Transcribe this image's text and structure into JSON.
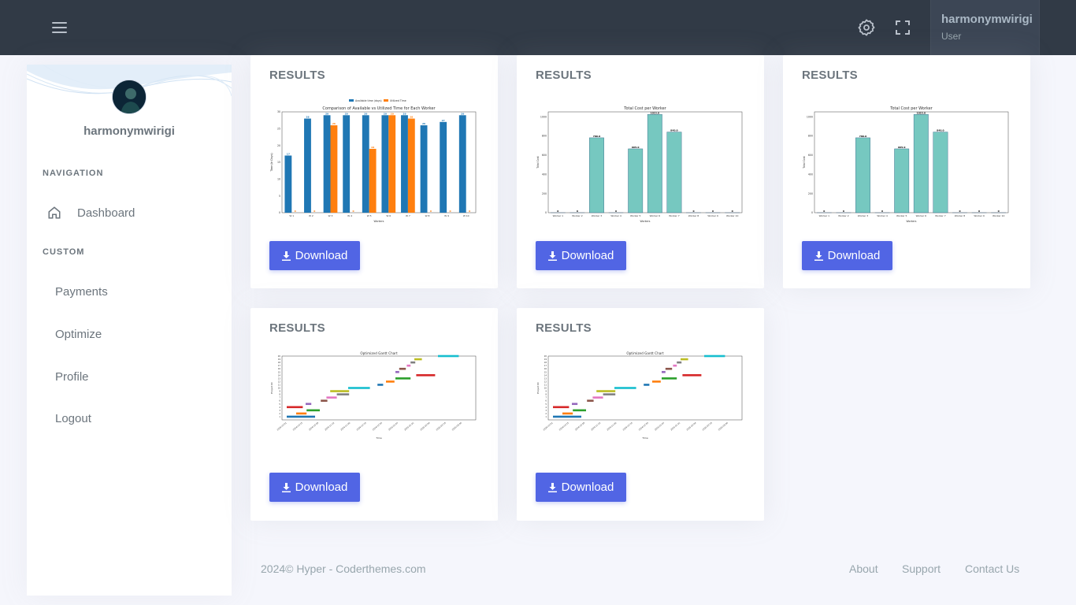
{
  "topbar": {
    "icons": [
      "menu-icon",
      "settings-icon",
      "fullscreen-icon"
    ],
    "user_name": "harmonymwirigi",
    "user_role": "User"
  },
  "sidebar": {
    "username": "harmonymwirigi",
    "nav_title": "NAVIGATION",
    "dashboard_label": "Dashboard",
    "custom_title": "CUSTOM",
    "items": [
      {
        "label": "Payments"
      },
      {
        "label": "Optimize"
      },
      {
        "label": "Profile"
      },
      {
        "label": "Logout"
      }
    ]
  },
  "cards": [
    {
      "title": "RESULTS",
      "download_label": "Download"
    },
    {
      "title": "RESULTS",
      "download_label": "Download"
    },
    {
      "title": "RESULTS",
      "download_label": "Download"
    },
    {
      "title": "RESULTS",
      "download_label": "Download"
    },
    {
      "title": "RESULTS",
      "download_label": "Download"
    }
  ],
  "chart_data": [
    {
      "type": "bar",
      "title": "Comparison of Available vs Utilized Time for Each Worker",
      "xlabel": "Workers",
      "ylabel": "Time (in Days)",
      "categories": [
        "W 1",
        "W 2",
        "W 3",
        "W 4",
        "W 5",
        "W 6",
        "W 7",
        "W 8",
        "W 9",
        "W 10"
      ],
      "series": [
        {
          "name": "Available time (days)",
          "color": "#1f77b4",
          "values": [
            17,
            28,
            29,
            29,
            29,
            29,
            29,
            26,
            27,
            29
          ]
        },
        {
          "name": "Utilized Time",
          "color": "#ff7f0e",
          "values": [
            0,
            0,
            26,
            0,
            19,
            29,
            28,
            0,
            0,
            0
          ]
        }
      ],
      "ylim": [
        0,
        30
      ],
      "yticks": [
        0,
        5,
        10,
        15,
        20,
        25,
        30
      ],
      "legend": "top-center"
    },
    {
      "type": "bar",
      "title": "Total Cost per Worker",
      "xlabel": "Workers",
      "ylabel": "Total Cost",
      "categories": [
        "Worker 1",
        "Worker 2",
        "Worker 3",
        "Worker 4",
        "Worker 5",
        "Worker 6",
        "Worker 7",
        "Worker 8",
        "Worker 9",
        "Worker 10"
      ],
      "values": [
        0,
        0,
        780.0,
        0,
        665.0,
        1023.0,
        840.0,
        0,
        0,
        0
      ],
      "color": "#76c8c0",
      "ylim": [
        0,
        1050
      ],
      "yticks": [
        0,
        200,
        400,
        600,
        800,
        1000
      ]
    },
    {
      "type": "bar",
      "title": "Total Cost per Worker",
      "xlabel": "Workers",
      "ylabel": "Total Cost",
      "categories": [
        "Worker 1",
        "Worker 2",
        "Worker 3",
        "Worker 4",
        "Worker 5",
        "Worker 6",
        "Worker 7",
        "Worker 8",
        "Worker 9",
        "Worker 10"
      ],
      "values": [
        0,
        0,
        780.0,
        0,
        665.0,
        1023.0,
        840.0,
        0,
        0,
        0
      ],
      "color": "#76c8c0",
      "ylim": [
        0,
        1050
      ],
      "yticks": [
        0,
        200,
        400,
        600,
        800,
        1000
      ]
    },
    {
      "type": "gantt",
      "title": "Optimized Gantt Chart",
      "xlabel": "Time",
      "ylabel": "Project ID",
      "xticks": [
        "2024-10-01",
        "2024-10-15",
        "2024-10-29",
        "2024-11-12",
        "2024-11-26",
        "2024-12-10",
        "2024-12-24",
        "2025-01-07",
        "2025-01-21",
        "2025-02-04",
        "2025-02-18",
        "2025-03-04"
      ],
      "tasks": [
        {
          "id": 1,
          "start": 0.0,
          "end": 3.0,
          "color": "#1f77b4"
        },
        {
          "id": 2,
          "start": 1.0,
          "end": 2.1,
          "color": "#ff7f0e"
        },
        {
          "id": 3,
          "start": 2.1,
          "end": 3.5,
          "color": "#2ca02c"
        },
        {
          "id": 4,
          "start": 0.0,
          "end": 1.7,
          "color": "#d62728"
        },
        {
          "id": 5,
          "start": 2.0,
          "end": 2.6,
          "color": "#9467bd"
        },
        {
          "id": 6,
          "start": 3.6,
          "end": 4.3,
          "color": "#8c564b"
        },
        {
          "id": 7,
          "start": 4.2,
          "end": 5.3,
          "color": "#e377c2"
        },
        {
          "id": 8,
          "start": 5.3,
          "end": 6.6,
          "color": "#7f7f7f"
        },
        {
          "id": 9,
          "start": 4.6,
          "end": 6.6,
          "color": "#bcbd22"
        },
        {
          "id": 10,
          "start": 6.5,
          "end": 8.8,
          "color": "#17becf"
        },
        {
          "id": 11,
          "start": 9.6,
          "end": 10.2,
          "color": "#1f77b4"
        },
        {
          "id": 12,
          "start": 10.5,
          "end": 11.4,
          "color": "#ff7f0e"
        },
        {
          "id": 13,
          "start": 11.5,
          "end": 13.1,
          "color": "#2ca02c"
        },
        {
          "id": 14,
          "start": 13.7,
          "end": 15.7,
          "color": "#d62728"
        },
        {
          "id": 15,
          "start": 11.5,
          "end": 11.9,
          "color": "#9467bd"
        },
        {
          "id": 16,
          "start": 11.9,
          "end": 12.6,
          "color": "#8c564b"
        },
        {
          "id": 17,
          "start": 12.7,
          "end": 13.1,
          "color": "#e377c2"
        },
        {
          "id": 18,
          "start": 13.1,
          "end": 13.6,
          "color": "#7f7f7f"
        },
        {
          "id": 19,
          "start": 13.5,
          "end": 14.3,
          "color": "#bcbd22"
        },
        {
          "id": 20,
          "start": 16.0,
          "end": 18.2,
          "color": "#17becf"
        }
      ],
      "xlim": [
        -0.5,
        20
      ],
      "ylim": [
        0,
        20
      ]
    },
    {
      "type": "gantt",
      "title": "Optimized Gantt Chart",
      "xlabel": "Time",
      "ylabel": "Project ID",
      "xticks": [
        "2024-10-01",
        "2024-10-15",
        "2024-10-29",
        "2024-11-12",
        "2024-11-26",
        "2024-12-10",
        "2024-12-24",
        "2025-01-07",
        "2025-01-21",
        "2025-02-04",
        "2025-02-18",
        "2025-03-04"
      ],
      "tasks": [
        {
          "id": 1,
          "start": 0.0,
          "end": 3.0,
          "color": "#1f77b4"
        },
        {
          "id": 2,
          "start": 1.0,
          "end": 2.1,
          "color": "#ff7f0e"
        },
        {
          "id": 3,
          "start": 2.1,
          "end": 3.5,
          "color": "#2ca02c"
        },
        {
          "id": 4,
          "start": 0.0,
          "end": 1.7,
          "color": "#d62728"
        },
        {
          "id": 5,
          "start": 2.0,
          "end": 2.6,
          "color": "#9467bd"
        },
        {
          "id": 6,
          "start": 3.6,
          "end": 4.3,
          "color": "#8c564b"
        },
        {
          "id": 7,
          "start": 4.2,
          "end": 5.3,
          "color": "#e377c2"
        },
        {
          "id": 8,
          "start": 5.3,
          "end": 6.6,
          "color": "#7f7f7f"
        },
        {
          "id": 9,
          "start": 4.6,
          "end": 6.6,
          "color": "#bcbd22"
        },
        {
          "id": 10,
          "start": 6.5,
          "end": 8.8,
          "color": "#17becf"
        },
        {
          "id": 11,
          "start": 9.6,
          "end": 10.2,
          "color": "#1f77b4"
        },
        {
          "id": 12,
          "start": 10.5,
          "end": 11.4,
          "color": "#ff7f0e"
        },
        {
          "id": 13,
          "start": 11.5,
          "end": 13.1,
          "color": "#2ca02c"
        },
        {
          "id": 14,
          "start": 13.7,
          "end": 15.7,
          "color": "#d62728"
        },
        {
          "id": 15,
          "start": 11.5,
          "end": 11.9,
          "color": "#9467bd"
        },
        {
          "id": 16,
          "start": 11.9,
          "end": 12.6,
          "color": "#8c564b"
        },
        {
          "id": 17,
          "start": 12.7,
          "end": 13.1,
          "color": "#e377c2"
        },
        {
          "id": 18,
          "start": 13.1,
          "end": 13.6,
          "color": "#7f7f7f"
        },
        {
          "id": 19,
          "start": 13.5,
          "end": 14.3,
          "color": "#bcbd22"
        },
        {
          "id": 20,
          "start": 16.0,
          "end": 18.2,
          "color": "#17becf"
        }
      ],
      "xlim": [
        -0.5,
        20
      ],
      "ylim": [
        0,
        20
      ]
    }
  ],
  "footer": {
    "copyright": "2024© Hyper - Coderthemes.com",
    "links": [
      "About",
      "Support",
      "Contact Us"
    ]
  }
}
